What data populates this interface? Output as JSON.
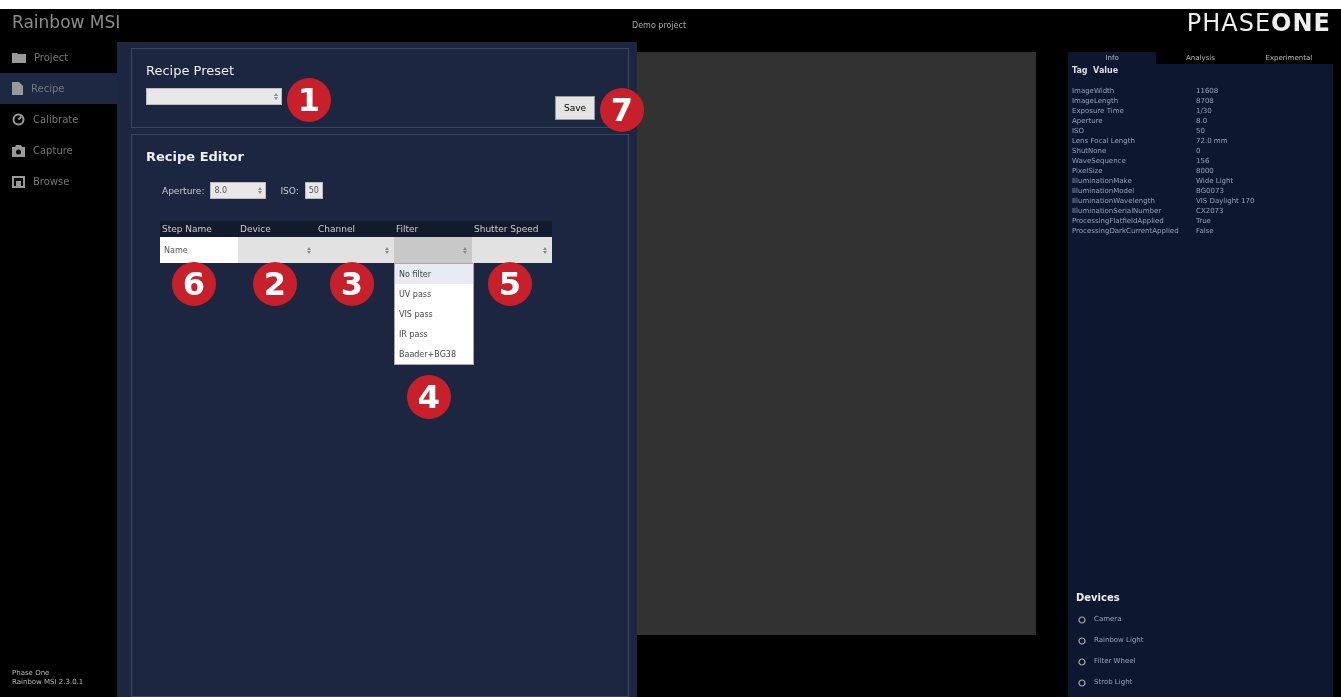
{
  "app_title": "Rainbow MSI",
  "project_title": "Demo project",
  "logo": {
    "light": "PHASE",
    "bold": "ONE"
  },
  "sidebar": {
    "items": [
      {
        "label": "Project",
        "selected": false
      },
      {
        "label": "Recipe",
        "selected": true
      },
      {
        "label": "Calibrate",
        "selected": false
      },
      {
        "label": "Capture",
        "selected": false
      },
      {
        "label": "Browse",
        "selected": false
      }
    ],
    "footer": [
      "Phase One",
      "Rainbow MSI 2.3.0.1"
    ]
  },
  "recipe_preset": {
    "title": "Recipe Preset",
    "save": "Save"
  },
  "recipe_editor": {
    "title": "Recipe Editor",
    "aperture_label": "Aperture:",
    "aperture": "8.0",
    "iso_label": "ISO:",
    "iso": "50",
    "columns": [
      "Step Name",
      "Device",
      "Channel",
      "Filter",
      "Shutter Speed"
    ],
    "row": {
      "name_placeholder": "Name"
    },
    "filter_options": [
      {
        "label": "No filter",
        "selected": true
      },
      {
        "label": "UV pass",
        "selected": false
      },
      {
        "label": "VIS pass",
        "selected": false
      },
      {
        "label": "IR pass",
        "selected": false
      },
      {
        "label": "Baader+BG38",
        "selected": false
      }
    ]
  },
  "callouts": [
    {
      "number": "1"
    },
    {
      "number": "7"
    },
    {
      "number": "6"
    },
    {
      "number": "2"
    },
    {
      "number": "3"
    },
    {
      "number": "5"
    },
    {
      "number": "4"
    }
  ],
  "info_panel": {
    "tabs": [
      {
        "label": "Info",
        "selected": true
      },
      {
        "label": "Analysis",
        "selected": false
      },
      {
        "label": "Experimental",
        "selected": false
      }
    ],
    "header": "Tag  Value",
    "rows": [
      {
        "tag": "ImageWidth",
        "value": "11608"
      },
      {
        "tag": "ImageLength",
        "value": "8708"
      },
      {
        "tag": "Exposure Time",
        "value": "1/30"
      },
      {
        "tag": "Aperture",
        "value": "8.0"
      },
      {
        "tag": "ISO",
        "value": "50"
      },
      {
        "tag": "Lens Focal Length",
        "value": "72.0 mm"
      },
      {
        "tag": "ShutNone",
        "value": "0"
      },
      {
        "tag": "WaveSequence",
        "value": "156"
      },
      {
        "tag": "PixelSize",
        "value": "8000"
      },
      {
        "tag": "IlluminationMake",
        "value": "Wide Light"
      },
      {
        "tag": "IlluminationModel",
        "value": "BG0073"
      },
      {
        "tag": "IlluminationWavelength",
        "value": "VIS Daylight 170"
      },
      {
        "tag": "IlluminationSerialNumber",
        "value": "CX2073"
      },
      {
        "tag": "ProcessingFlatfieldApplied",
        "value": "True"
      },
      {
        "tag": "ProcessingDarkCurrentApplied",
        "value": "False"
      }
    ]
  },
  "devices": {
    "title": "Devices",
    "items": [
      "Camera",
      "Rainbow Light",
      "Filter Wheel",
      "Strob Light"
    ]
  }
}
